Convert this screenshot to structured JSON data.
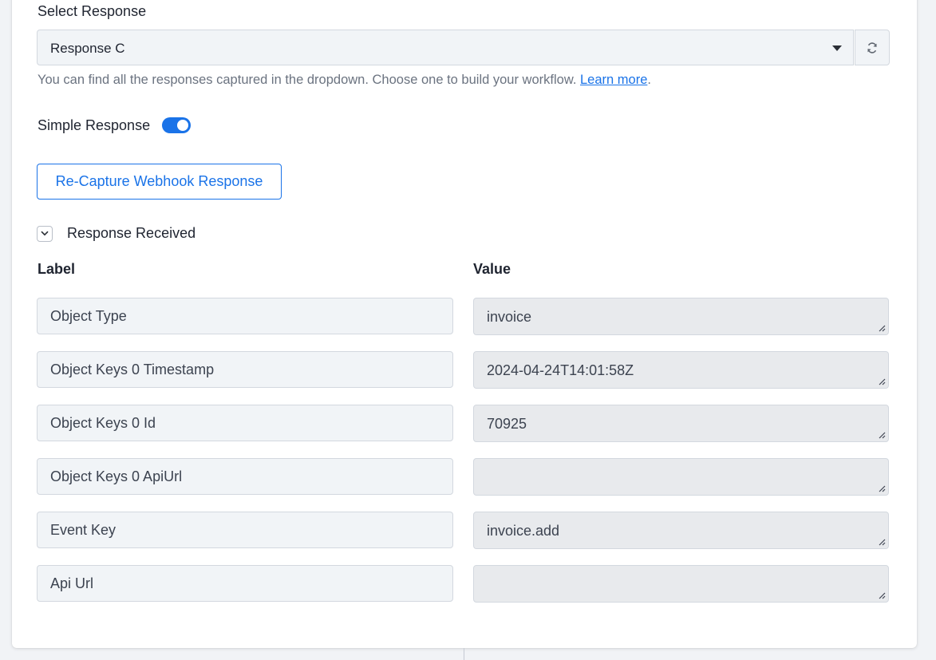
{
  "select": {
    "label": "Select Response",
    "value": "Response C",
    "help_text": "You can find all the responses captured in the dropdown. Choose one to build your workflow.",
    "help_link": "Learn more",
    "help_suffix": "."
  },
  "simple_response": {
    "label": "Simple Response",
    "enabled": true
  },
  "recapture_button": "Re-Capture Webhook Response",
  "response_section": {
    "title": "Response Received",
    "expanded": true
  },
  "table": {
    "label_header": "Label",
    "value_header": "Value",
    "rows": [
      {
        "label": "Object Type",
        "value": "invoice"
      },
      {
        "label": "Object Keys 0 Timestamp",
        "value": "2024-04-24T14:01:58Z"
      },
      {
        "label": "Object Keys 0 Id",
        "value": "70925"
      },
      {
        "label": "Object Keys 0 ApiUrl",
        "value": ""
      },
      {
        "label": "Event Key",
        "value": "invoice.add"
      },
      {
        "label": "Api Url",
        "value": ""
      }
    ]
  },
  "colors": {
    "accent": "#1a73e8",
    "field_bg": "#f1f4f7",
    "value_bg": "#e8eaed",
    "border": "#d3d8df"
  }
}
